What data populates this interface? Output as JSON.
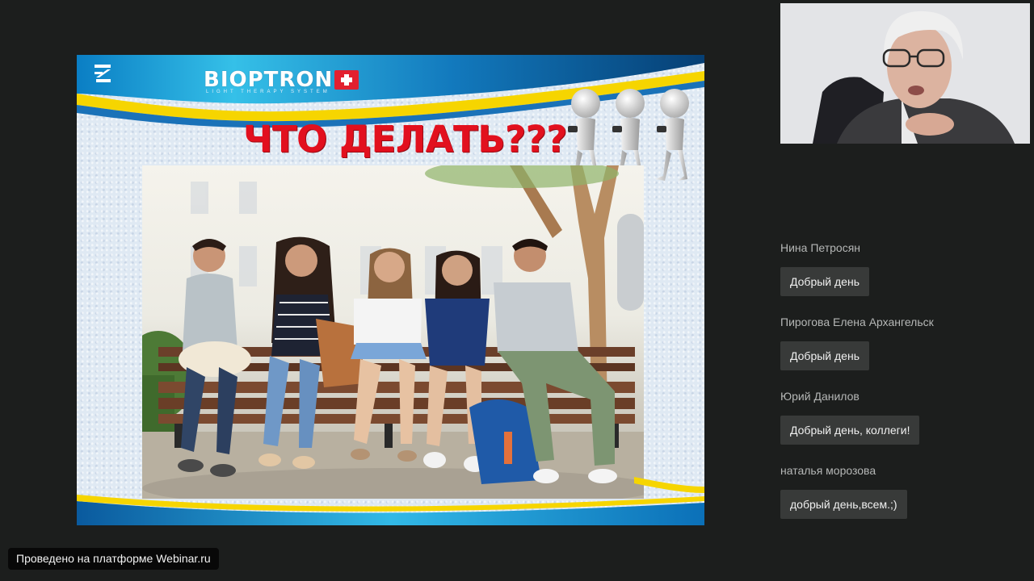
{
  "slide": {
    "brand": "BIOPTRON",
    "brand_tagline": "LIGHT THERAPY SYSTEM",
    "title": "ЧТО ДЕЛАТЬ???",
    "colors": {
      "title": "#e2101e",
      "band_blue": "#1a72b8",
      "band_yellow": "#f6d500",
      "brand_red": "#e2202f"
    },
    "decorations": [
      "zepter-logo-icon",
      "swiss-cross-icon",
      "phone-figures-illustration",
      "students-on-bench-photo"
    ]
  },
  "webcam": {
    "label": "presenter-video"
  },
  "chat": {
    "messages": [
      {
        "author": "Нина Петросян",
        "text": "Добрый день"
      },
      {
        "author": "Пирогова Елена Архангельск",
        "text": "Добрый день"
      },
      {
        "author": "Юрий Данилов",
        "text": "Добрый день, коллеги!"
      },
      {
        "author": "наталья морозова",
        "text": "добрый день,всем.;)"
      }
    ]
  },
  "footer": {
    "platform": "Проведено на платформе Webinar.ru"
  }
}
